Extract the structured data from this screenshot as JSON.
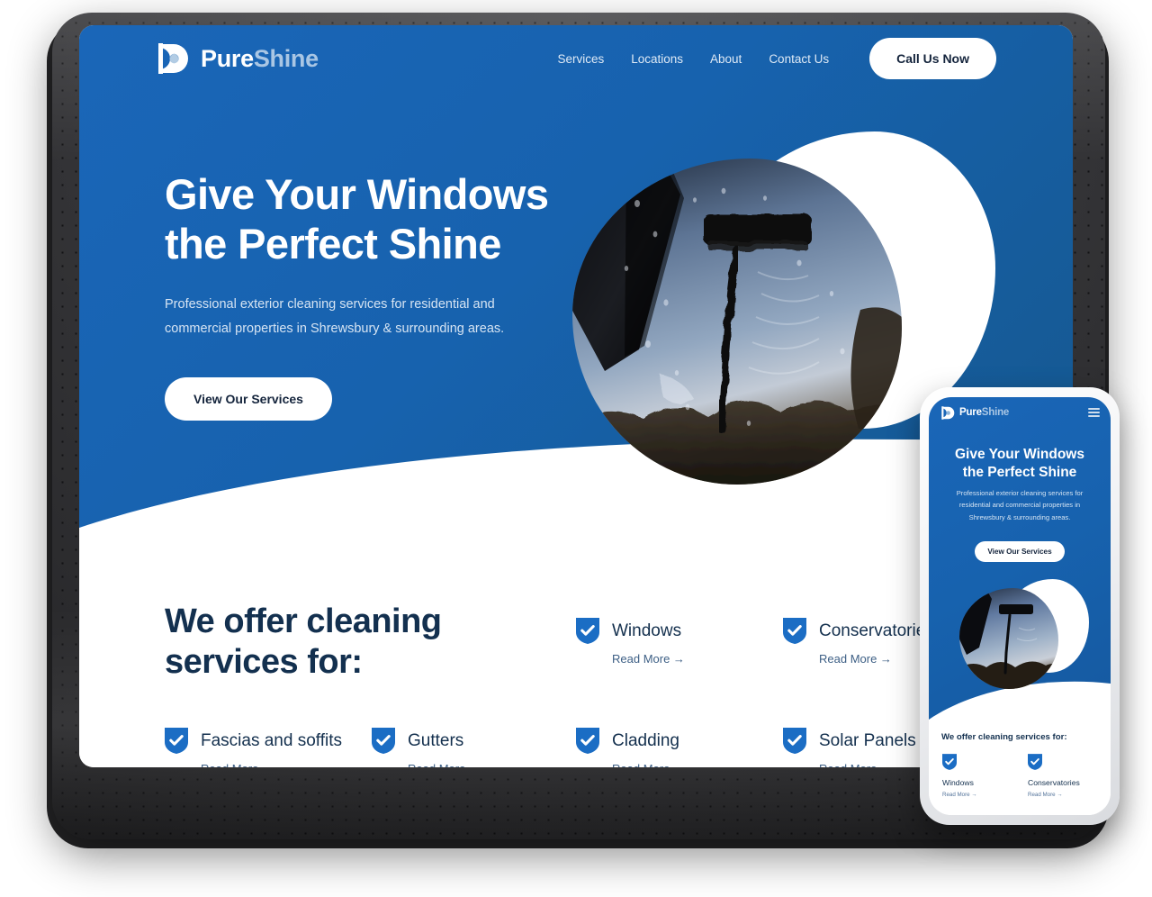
{
  "brand": {
    "name_primary": "Pure",
    "name_secondary": "Shine",
    "logo_icon": "droplet-d-logo-icon",
    "primary_color": "#1a66b8",
    "dark_navy": "#13304f",
    "accent_light": "#a9c6e4"
  },
  "header": {
    "nav": [
      {
        "label": "Services"
      },
      {
        "label": "Locations"
      },
      {
        "label": "About"
      },
      {
        "label": "Contact Us"
      }
    ],
    "cta_label": "Call Us Now"
  },
  "hero": {
    "title_line1": "Give Your Windows",
    "title_line2": "the Perfect Shine",
    "subtitle": "Professional exterior cleaning services for residential and commercial properties in Shrewsbury & surrounding areas.",
    "button_label": "View Our Services",
    "image_alt": "squeegee-on-wet-window-photo"
  },
  "services": {
    "heading_line1": "We offer cleaning",
    "heading_line2": "services for:",
    "read_more_label": "Read More →",
    "check_icon": "check-shield-icon",
    "items": [
      {
        "label": "Windows"
      },
      {
        "label": "Conservatories"
      },
      {
        "label": "Fascias and soffits"
      },
      {
        "label": "Gutters"
      },
      {
        "label": "Cladding"
      },
      {
        "label": "Solar Panels"
      }
    ]
  },
  "mobile": {
    "menu_icon": "hamburger-menu-icon",
    "title_line1": "Give Your Windows",
    "title_line2": "the Perfect Shine",
    "subtitle": "Professional exterior cleaning services for residential and commercial properties in Shrewsbury & surrounding areas.",
    "button_label": "View Our Services",
    "services_heading": "We offer cleaning services for:",
    "read_more_label": "Read More →",
    "items": [
      {
        "label": "Windows"
      },
      {
        "label": "Conservatories"
      }
    ]
  }
}
